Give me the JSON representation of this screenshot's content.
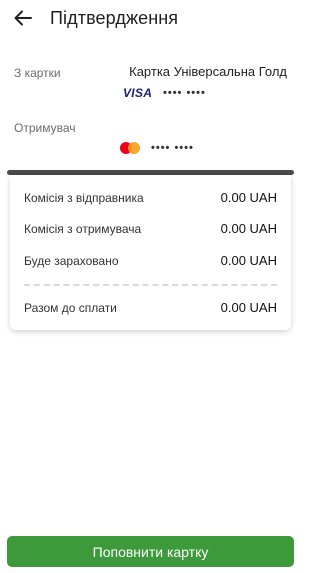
{
  "header": {
    "title": "Підтвердження",
    "back_icon": "arrow-left-icon"
  },
  "from": {
    "label": "З картки",
    "card_name": "Картка Універсальна Голд",
    "brand": "VISA",
    "masked_number": "•••• ••••"
  },
  "to": {
    "label": "Отримувач",
    "brand_icon": "mastercard-icon",
    "masked_number": "•••• ••••"
  },
  "summary": {
    "rows": [
      {
        "label": "Комісія з відправника",
        "value": "0.00 UAH"
      },
      {
        "label": "Комісія з отримувача",
        "value": "0.00 UAH"
      },
      {
        "label": "Буде зараховано",
        "value": "0.00 UAH"
      }
    ],
    "total": {
      "label": "Разом до сплати",
      "value": "0.00 UAH"
    }
  },
  "actions": {
    "submit_label": "Поповнити картку"
  },
  "colors": {
    "accent": "#3d9a3b",
    "visa": "#1a1f71",
    "mc_red": "#eb001b",
    "mc_orange": "#f79e1b"
  }
}
